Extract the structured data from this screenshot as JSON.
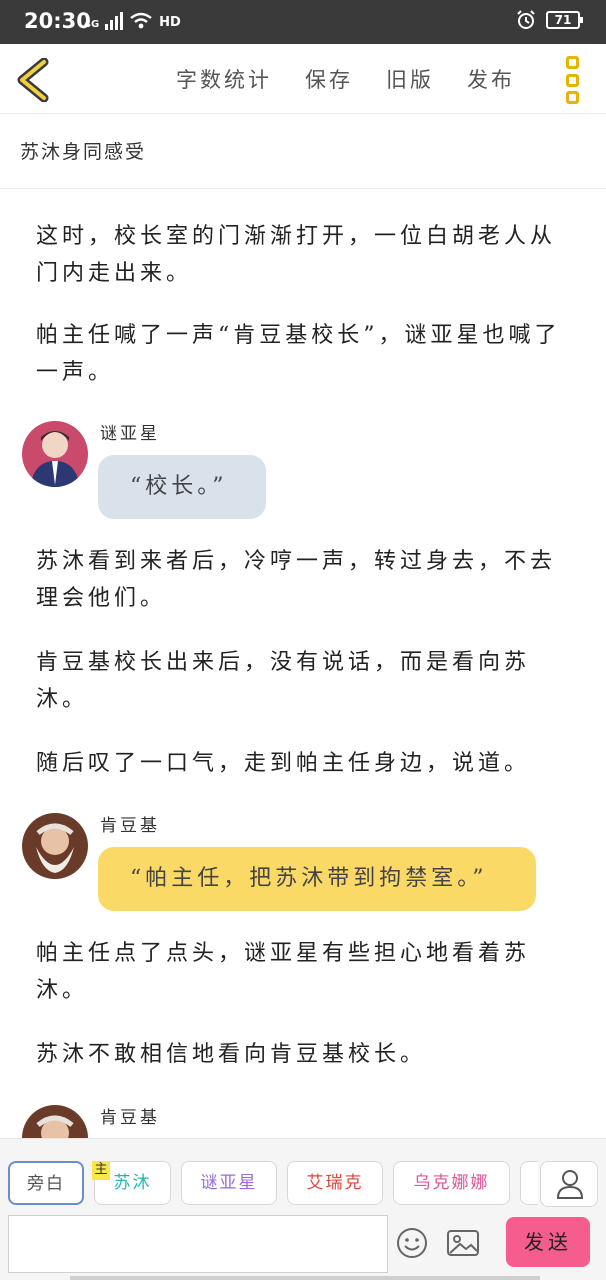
{
  "status_bar": {
    "time": "20:30",
    "network": "4G",
    "hd": "HD",
    "battery": "71"
  },
  "toolbar": {
    "actions": [
      "字数统计",
      "保存",
      "旧版",
      "发布"
    ]
  },
  "chapter": {
    "title": "苏沐身同感受"
  },
  "content": {
    "p1": "这时，校长室的门渐渐打开，一位白胡老人从门内走出来。",
    "p2": "帕主任喊了一声“肯豆基校长”，谜亚星也喊了一声。",
    "m1": {
      "speaker": "谜亚星",
      "text": "“校长。”"
    },
    "p3": "苏沐看到来者后，冷哼一声，转过身去，不去理会他们。",
    "p4": "肯豆基校长出来后，没有说话，而是看向苏沐。",
    "p5": "随后叹了一口气，走到帕主任身边，说道。",
    "m2": {
      "speaker": "肯豆基",
      "text": "“帕主任，把苏沐带到拘禁室。”"
    },
    "p6": "帕主任点了点头，谜亚星有些担心地看着苏沐。",
    "p7": "苏沐不敢相信地看向肯豆基校长。",
    "m3": {
      "speaker": "肯豆基"
    }
  },
  "role_bar": {
    "roles": [
      {
        "label": "旁白",
        "color": "#555555"
      },
      {
        "label": "苏沐",
        "color": "#1fb7b0",
        "badge": "主"
      },
      {
        "label": "谜亚星",
        "color": "#9b6bd6"
      },
      {
        "label": "艾瑞克",
        "color": "#e0443a"
      },
      {
        "label": "乌克娜娜",
        "color": "#e0529a"
      }
    ]
  },
  "composer": {
    "send_label": "发送"
  }
}
